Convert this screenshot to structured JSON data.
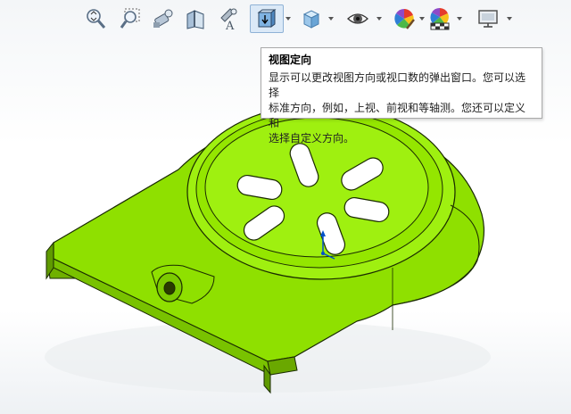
{
  "toolbar": {
    "buttons": [
      {
        "icon": "zoom-to-fit-icon"
      },
      {
        "icon": "zoom-to-area-icon"
      },
      {
        "icon": "previous-view-icon"
      },
      {
        "icon": "section-view-icon"
      },
      {
        "icon": "dynamic-annotation-icon"
      },
      {
        "icon": "view-orientation-icon",
        "active": true,
        "has_menu": true
      },
      {
        "icon": "display-style-icon",
        "has_menu": true
      },
      {
        "icon": "hide-show-items-icon",
        "has_menu": true
      },
      {
        "icon": "edit-appearance-icon",
        "has_menu": true
      },
      {
        "icon": "apply-scene-icon",
        "has_menu": true
      },
      {
        "icon": "view-settings-icon",
        "has_menu": true
      }
    ]
  },
  "tooltip": {
    "title": "视图定向",
    "lines": [
      "显示可以更改视图方向或视口数的弹出窗口。您可以选择",
      "标准方向，例如，上视、前视和等轴测。您还可以定义和",
      "选择自定义方向。"
    ]
  },
  "model": {
    "color": "#8fe000",
    "edge_color": "#1a2a00"
  }
}
